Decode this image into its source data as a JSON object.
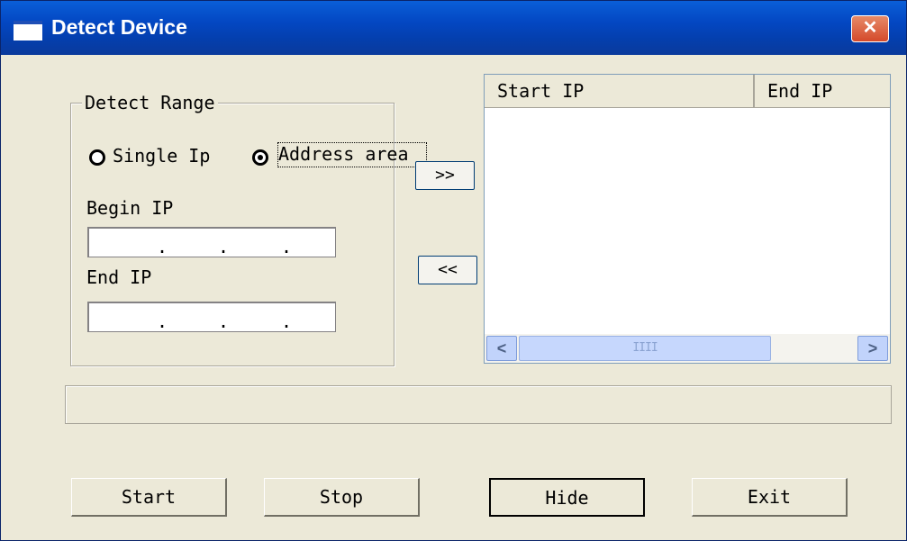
{
  "window": {
    "title": "Detect Device",
    "close_label": "✕"
  },
  "detect_range": {
    "label": "Detect Range",
    "single_ip_label": "Single Ip",
    "address_area_label": "Address area",
    "selected": "address_area",
    "begin_ip_label": "Begin IP",
    "end_ip_label": "End IP",
    "begin_ip_value": [
      "",
      "",
      "",
      ""
    ],
    "end_ip_value": [
      "",
      "",
      "",
      ""
    ]
  },
  "transfer": {
    "add_label": ">>",
    "remove_label": "<<"
  },
  "list": {
    "columns": [
      "Start IP",
      "End IP"
    ],
    "rows": [],
    "scroll_thumb": "IIII",
    "scroll_left": "<",
    "scroll_right": ">"
  },
  "status_text": "",
  "buttons": {
    "start": "Start",
    "stop": "Stop",
    "hide": "Hide",
    "exit": "Exit"
  }
}
